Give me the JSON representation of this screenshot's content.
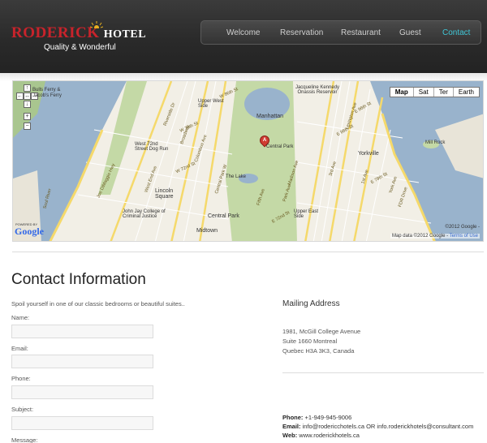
{
  "header": {
    "brand_red": "RODERICK",
    "brand_white": "HOTEL",
    "tagline": "Quality & Wonderful",
    "nav": [
      {
        "label": "Welcome",
        "active": false
      },
      {
        "label": "Reservation",
        "active": false
      },
      {
        "label": "Restaurant",
        "active": false
      },
      {
        "label": "Guest",
        "active": false
      },
      {
        "label": "Contact",
        "active": true
      }
    ]
  },
  "map": {
    "types": [
      "Map",
      "Sat",
      "Ter",
      "Earth"
    ],
    "marker": "A",
    "powered": "POWERED BY",
    "google": "Google",
    "copyright_top": "©2012 Google -",
    "copyright_bottom": "Map data ©2012 Google -",
    "terms": "Terms of Use",
    "labels": {
      "bulls_ferry": "Bulls Ferry &",
      "jacobs_ferry": "Jacob's Ferry",
      "reservoir": "Jacqueline Kennedy Onassis Reservoir",
      "upper_west_side": "Upper West Side",
      "manhattan": "Manhattan",
      "central_park_m": "Central Park",
      "the_lake": "The Lake",
      "mill_rock": "Mill Rock",
      "yorkville": "Yorkville",
      "upper_east_side": "Upper East Side",
      "lincoln_square": "Lincoln Square",
      "central_park": "Central Park",
      "midtown": "Midtown",
      "john_jay": "John Jay College of Criminal Justice",
      "west72": "West 72nd Street Dog Run",
      "west_end": "West End Ave",
      "joe_dimaggio": "Joe DiMaggio Hwy",
      "soul_river": "Soul River",
      "riverside": "Riverside Dr",
      "broadway": "Broadway",
      "columbus": "Columbus Ave",
      "w86": "W 86th St",
      "w79": "W 79th St",
      "w72": "W 72nd St",
      "e96": "E 96th St",
      "e86": "E 86th St",
      "e79": "E 79th St",
      "e72": "E 72nd St",
      "fifth": "Fifth Ave",
      "park": "Park Ave",
      "madison": "Madison Ave",
      "lexington": "Lexington Ave",
      "third": "3rd Ave",
      "first": "1st Ave",
      "york": "York Ave",
      "fdr": "FDR Drive",
      "central_park_w": "Central Park W"
    }
  },
  "contact": {
    "title": "Contact Information",
    "intro": "Spoil yourself in one of our classic bedrooms or beautiful suites..",
    "fields": [
      {
        "label": "Name:",
        "value": ""
      },
      {
        "label": "Email:",
        "value": ""
      },
      {
        "label": "Phone:",
        "value": ""
      },
      {
        "label": "Subject:",
        "value": ""
      },
      {
        "label": "Message:",
        "value": ""
      }
    ]
  },
  "mailing": {
    "title": "Mailing Address",
    "lines": [
      "1981, McGill College Avenue",
      "Suite 1660 Montreal",
      "Quebec H3A 3K3, Canada"
    ],
    "phone_label": "Phone:",
    "phone": "+1-949-945-9006",
    "email_label": "Email:",
    "email": "info@rodericchotels.ca OR info.roderickhotels@consultant.com",
    "web_label": "Web:",
    "web": "www.roderickhotels.ca"
  },
  "colors": {
    "accent": "#3fc6d6",
    "brand_red": "#c8232b",
    "header_bg": "#2a2a2a"
  }
}
